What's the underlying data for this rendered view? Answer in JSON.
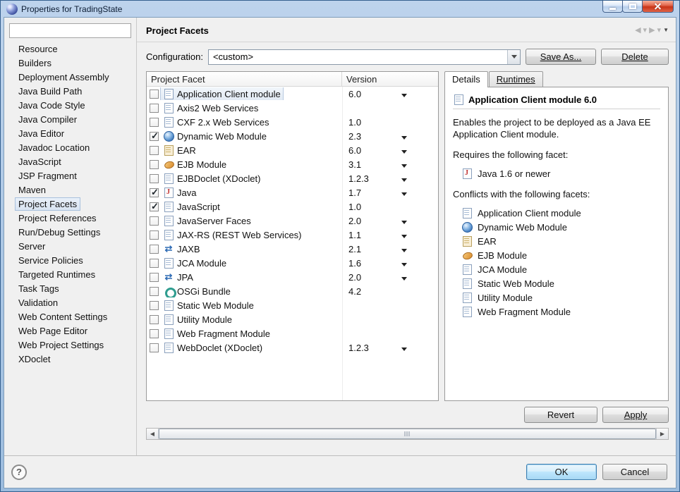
{
  "window": {
    "title": "Properties for TradingState"
  },
  "sidebar": {
    "filter_value": "",
    "items": [
      {
        "label": "Resource"
      },
      {
        "label": "Builders"
      },
      {
        "label": "Deployment Assembly"
      },
      {
        "label": "Java Build Path"
      },
      {
        "label": "Java Code Style"
      },
      {
        "label": "Java Compiler"
      },
      {
        "label": "Java Editor"
      },
      {
        "label": "Javadoc Location"
      },
      {
        "label": "JavaScript"
      },
      {
        "label": "JSP Fragment"
      },
      {
        "label": "Maven"
      },
      {
        "label": "Project Facets",
        "selected": true
      },
      {
        "label": "Project References"
      },
      {
        "label": "Run/Debug Settings"
      },
      {
        "label": "Server"
      },
      {
        "label": "Service Policies"
      },
      {
        "label": "Targeted Runtimes"
      },
      {
        "label": "Task Tags"
      },
      {
        "label": "Validation"
      },
      {
        "label": "Web Content Settings"
      },
      {
        "label": "Web Page Editor"
      },
      {
        "label": "Web Project Settings"
      },
      {
        "label": "XDoclet"
      }
    ]
  },
  "header": {
    "title": "Project Facets"
  },
  "configuration": {
    "label": "Configuration:",
    "value": "<custom>",
    "save_as_label": "Save As...",
    "delete_label": "Delete"
  },
  "facet_table": {
    "columns": [
      "Project Facet",
      "Version"
    ],
    "rows": [
      {
        "label": "Application Client module",
        "version": "6.0",
        "checked": false,
        "selected": true,
        "has_dropdown": true,
        "icon": "file"
      },
      {
        "label": "Axis2 Web Services",
        "version": "",
        "checked": false,
        "has_dropdown": false,
        "icon": "file"
      },
      {
        "label": "CXF 2.x Web Services",
        "version": "1.0",
        "checked": false,
        "has_dropdown": false,
        "icon": "file"
      },
      {
        "label": "Dynamic Web Module",
        "version": "2.3",
        "checked": true,
        "has_dropdown": true,
        "icon": "globe"
      },
      {
        "label": "EAR",
        "version": "6.0",
        "checked": false,
        "has_dropdown": true,
        "icon": "ear"
      },
      {
        "label": "EJB Module",
        "version": "3.1",
        "checked": false,
        "has_dropdown": true,
        "icon": "bean"
      },
      {
        "label": "EJBDoclet (XDoclet)",
        "version": "1.2.3",
        "checked": false,
        "has_dropdown": true,
        "icon": "file"
      },
      {
        "label": "Java",
        "version": "1.7",
        "checked": true,
        "has_dropdown": true,
        "icon": "java"
      },
      {
        "label": "JavaScript",
        "version": "1.0",
        "checked": true,
        "has_dropdown": false,
        "icon": "file"
      },
      {
        "label": "JavaServer Faces",
        "version": "2.0",
        "checked": false,
        "has_dropdown": true,
        "icon": "file"
      },
      {
        "label": "JAX-RS (REST Web Services)",
        "version": "1.1",
        "checked": false,
        "has_dropdown": true,
        "icon": "file"
      },
      {
        "label": "JAXB",
        "version": "2.1",
        "checked": false,
        "has_dropdown": true,
        "icon": "arrows"
      },
      {
        "label": "JCA Module",
        "version": "1.6",
        "checked": false,
        "has_dropdown": true,
        "icon": "file"
      },
      {
        "label": "JPA",
        "version": "2.0",
        "checked": false,
        "has_dropdown": true,
        "icon": "arrows"
      },
      {
        "label": "OSGi Bundle",
        "version": "4.2",
        "checked": false,
        "has_dropdown": false,
        "icon": "osgi"
      },
      {
        "label": "Static Web Module",
        "version": "",
        "checked": false,
        "has_dropdown": false,
        "icon": "file"
      },
      {
        "label": "Utility Module",
        "version": "",
        "checked": false,
        "has_dropdown": false,
        "icon": "file"
      },
      {
        "label": "Web Fragment Module",
        "version": "",
        "checked": false,
        "has_dropdown": false,
        "icon": "file"
      },
      {
        "label": "WebDoclet (XDoclet)",
        "version": "1.2.3",
        "checked": false,
        "has_dropdown": true,
        "icon": "file"
      }
    ]
  },
  "details": {
    "tabs": [
      {
        "label": "Details",
        "active": true
      },
      {
        "label": "Runtimes",
        "active": false
      }
    ],
    "title": "Application Client module 6.0",
    "description": "Enables the project to be deployed as a Java EE Application Client module.",
    "requires_heading": "Requires the following facet:",
    "requires": [
      {
        "label": "Java 1.6 or newer",
        "icon": "java"
      }
    ],
    "conflicts_heading": "Conflicts with the following facets:",
    "conflicts": [
      {
        "label": "Application Client module",
        "icon": "file"
      },
      {
        "label": "Dynamic Web Module",
        "icon": "globe"
      },
      {
        "label": "EAR",
        "icon": "ear"
      },
      {
        "label": "EJB Module",
        "icon": "bean"
      },
      {
        "label": "JCA Module",
        "icon": "file"
      },
      {
        "label": "Static Web Module",
        "icon": "file"
      },
      {
        "label": "Utility Module",
        "icon": "file"
      },
      {
        "label": "Web Fragment Module",
        "icon": "file"
      }
    ]
  },
  "actions": {
    "revert_label": "Revert",
    "apply_label": "Apply"
  },
  "footer": {
    "help_label": "?",
    "ok_label": "OK",
    "cancel_label": "Cancel"
  },
  "colors": {
    "titlebar_blue": "#bdd3ec",
    "close_red": "#c93417",
    "selection_highlight": "#e2eaf4",
    "dialog_bg": "#f0f0f0",
    "default_button_border": "#3c7fb1"
  }
}
